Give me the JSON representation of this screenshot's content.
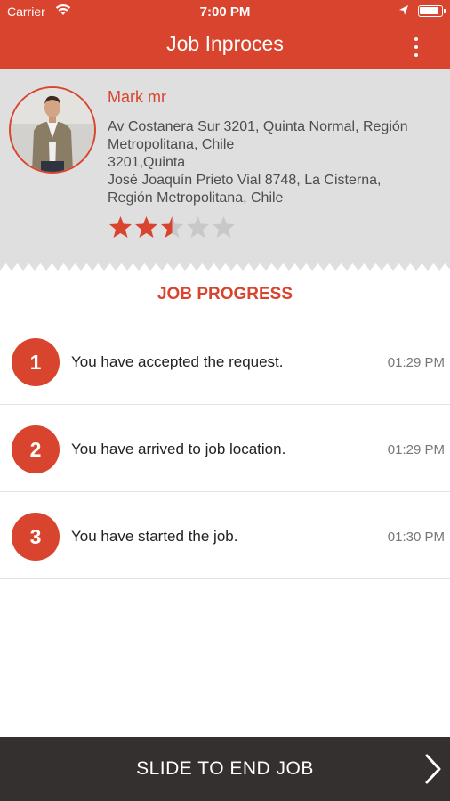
{
  "status_bar": {
    "carrier": "Carrier",
    "time": "7:00 PM"
  },
  "header": {
    "title": "Job Inproces",
    "bg_color": "#d9442f"
  },
  "profile": {
    "name": "Mark mr",
    "address_lines": [
      "Av Costanera Sur 3201, Quinta Normal, Región",
      "Metropolitana, Chile",
      "3201,Quinta",
      "José Joaquín Prieto Vial 8748,  La Cisterna,",
      "Región Metropolitana,  Chile"
    ],
    "rating": 2.5,
    "rating_max": 5
  },
  "progress": {
    "title": "JOB PROGRESS",
    "steps": [
      {
        "number": "1",
        "text": "You have accepted the request.",
        "time": "01:29 PM"
      },
      {
        "number": "2",
        "text": "You have arrived to job location.",
        "time": "01:29 PM"
      },
      {
        "number": "3",
        "text": "You have started the job.",
        "time": "01:30 PM"
      }
    ]
  },
  "footer": {
    "slide_label": "SLIDE TO END JOB",
    "icon": "chevron-right-icon"
  },
  "colors": {
    "accent": "#d9442f",
    "profile_bg": "#dfdfdf",
    "footer_bg": "#34302f",
    "star_empty": "#c8c8c8"
  }
}
